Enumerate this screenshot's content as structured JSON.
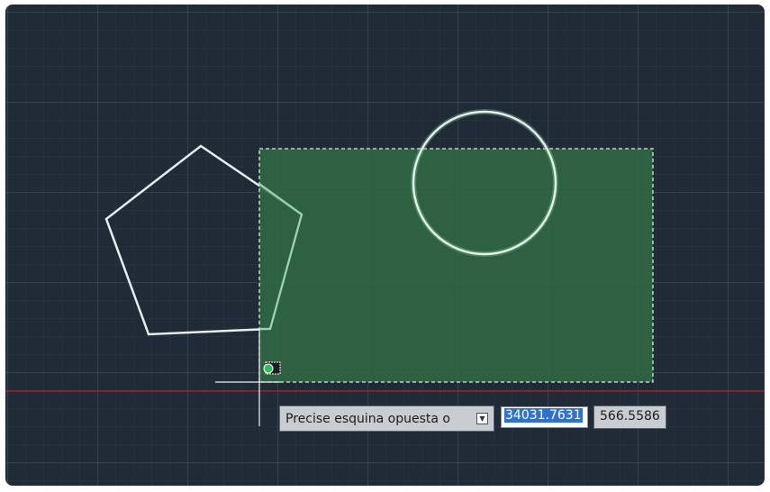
{
  "viewport": {
    "background": "#212b38"
  },
  "selection": {
    "fill_color": "#2f6e43",
    "border_color": "#dfe9e2"
  },
  "axis_line_color": "#b51f2a",
  "prompt": {
    "text": "Precise esquina opuesta o",
    "menu_icon": "dropdown-arrow-icon"
  },
  "coords": {
    "x": "34031.7631",
    "y": "566.5586"
  }
}
